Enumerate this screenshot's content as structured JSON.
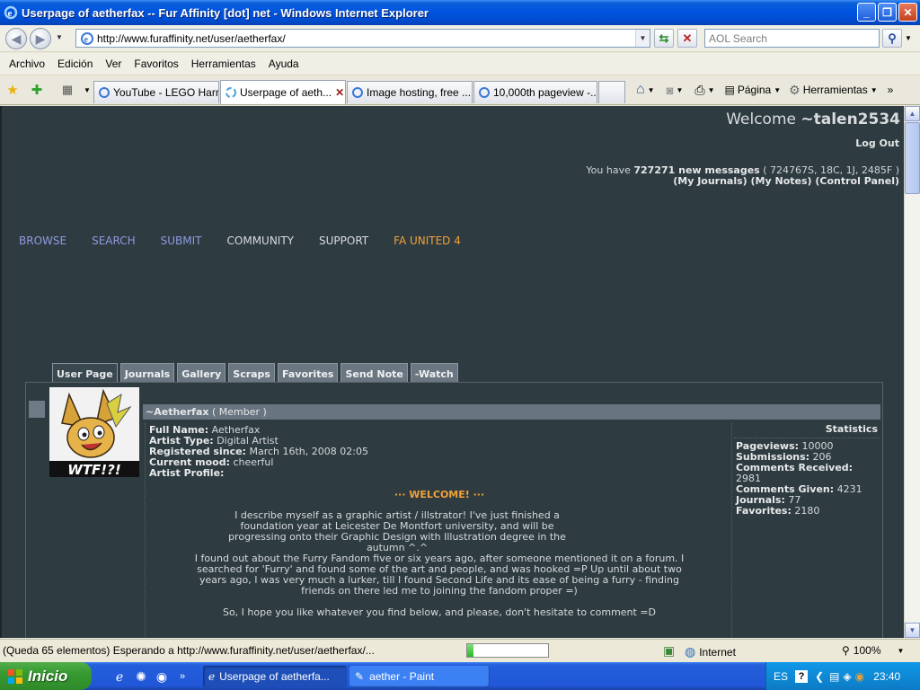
{
  "window": {
    "title": "Userpage of aetherfax -- Fur Affinity [dot] net - Windows Internet Explorer",
    "min_label": "_",
    "max_label": "❐",
    "close_label": "✕"
  },
  "address_bar": {
    "url": "http://www.furaffinity.net/user/aetherfax/",
    "search_placeholder": "AOL Search"
  },
  "menu": {
    "items": [
      "Archivo",
      "Edición",
      "Ver",
      "Favoritos",
      "Herramientas",
      "Ayuda"
    ]
  },
  "tabs": [
    {
      "label": "YouTube - LEGO Harr..."
    },
    {
      "label": "Userpage of aeth...",
      "close": "✕"
    },
    {
      "label": "Image hosting, free ..."
    },
    {
      "label": "10,000th pageview -..."
    }
  ],
  "command_bar": {
    "page_label": "Página",
    "tools_label": "Herramientas",
    "more_label": "»"
  },
  "site": {
    "welcome_prefix": "Welcome ",
    "username": "~talen2534",
    "logout": "Log Out",
    "msg_prefix": "You have ",
    "msg_count": "727271 new messages",
    "msg_detail": " ( 724767S, 18C, 1J, 2485F )",
    "links": "(My Journals) (My Notes) (Control Panel)",
    "nav": [
      {
        "label": "BROWSE",
        "color": "#8f9be0"
      },
      {
        "label": "SEARCH",
        "color": "#8f9be0"
      },
      {
        "label": "SUBMIT",
        "color": "#8f9be0"
      },
      {
        "label": "COMMUNITY",
        "color": "#d8dcde"
      },
      {
        "label": "SUPPORT",
        "color": "#d8dcde"
      },
      {
        "label": "FA UNITED 4",
        "color": "#f0a23a"
      }
    ],
    "page_tabs": [
      "User Page",
      "Journals",
      "Gallery",
      "Scraps",
      "Favorites",
      "Send Note",
      "-Watch"
    ]
  },
  "profile": {
    "avatar_caption": "WTF!?!",
    "name": "~Aetherfax",
    "rank": " ( Member )",
    "fields": [
      {
        "label": "Full Name:",
        "value": " Aetherfax"
      },
      {
        "label": "Artist Type:",
        "value": " Digital Artist"
      },
      {
        "label": "Registered since:",
        "value": " March 16th, 2008 02:05"
      },
      {
        "label": "Current mood:",
        "value": " cheerful"
      },
      {
        "label": "Artist Profile:",
        "value": ""
      }
    ],
    "welcome_heading": "··· WELCOME! ···",
    "para1": "I describe myself as a graphic artist / illstrator! I've just finished a foundation year at Leicester De Montfort university, and will be progressing onto their Graphic Design with Illustration degree in the autumn ^.^",
    "para2": "I found out about the Furry Fandom five or six years ago, after someone mentioned it on a forum. I searched for 'Furry' and found some of the art and people, and was hooked =P Up until about two years ago, I was very much a lurker, till I found Second Life and its ease of being a furry - finding friends on there led me to joining the fandom proper =)",
    "para3": "So, I hope you like whatever you find below, and please, don't hesitate to comment =D"
  },
  "stats": {
    "heading": "Statistics",
    "rows": [
      {
        "label": "Pageviews:",
        "value": " 10000"
      },
      {
        "label": "Submissions:",
        "value": " 206"
      },
      {
        "label": "Comments Received:",
        "value": " 2981"
      },
      {
        "label": "Comments Given:",
        "value": " 4231"
      },
      {
        "label": "Journals:",
        "value": " 77"
      },
      {
        "label": "Favorites:",
        "value": " 2180"
      }
    ]
  },
  "statusbar": {
    "text": "(Queda 65 elementos) Esperando a http://www.furaffinity.net/user/aetherfax/...",
    "progress": 0.08,
    "zone": "Internet",
    "zoom": "100%"
  },
  "taskbar": {
    "start": "Inicio",
    "items": [
      {
        "label": "Userpage of aetherfa..."
      },
      {
        "label": "aether - Paint"
      }
    ],
    "lang": "ES",
    "clock": "23:40",
    "quick_more": "»"
  }
}
